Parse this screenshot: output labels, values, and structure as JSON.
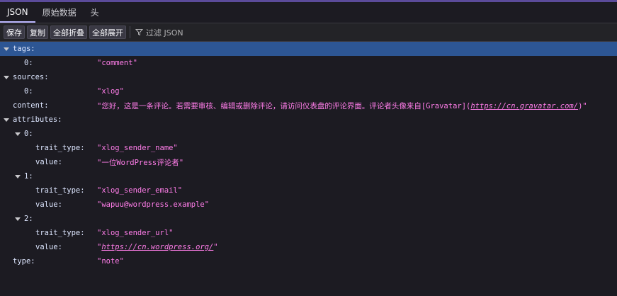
{
  "tabs": [
    {
      "label": "JSON"
    },
    {
      "label": "原始数据"
    },
    {
      "label": "头"
    }
  ],
  "toolbar": {
    "save": "保存",
    "copy": "复制",
    "collapse_all": "全部折叠",
    "expand_all": "全部展开",
    "filter_label": "过滤 JSON"
  },
  "tree": {
    "tags_key": "tags:",
    "tags_0_key": "0:",
    "tags_0_val": "\"comment\"",
    "sources_key": "sources:",
    "sources_0_key": "0:",
    "sources_0_val": "\"xlog\"",
    "content_key": "content:",
    "content_val_prefix": "\"您好，这是一条评论。若需要审核、编辑或删除评论，请访问仪表盘的评论界面。评论者头像来自[Gravatar](",
    "content_val_link": "https://cn.gravatar.com/",
    "content_val_suffix": ")\"",
    "attributes_key": "attributes:",
    "attr0_key": "0:",
    "attr0_trait_key": "trait_type:",
    "attr0_trait_val": "\"xlog_sender_name\"",
    "attr0_value_key": "value:",
    "attr0_value_val": "\"一位WordPress评论者\"",
    "attr1_key": "1:",
    "attr1_trait_key": "trait_type:",
    "attr1_trait_val": "\"xlog_sender_email\"",
    "attr1_value_key": "value:",
    "attr1_value_val": "\"wapuu@wordpress.example\"",
    "attr2_key": "2:",
    "attr2_trait_key": "trait_type:",
    "attr2_trait_val": "\"xlog_sender_url\"",
    "attr2_value_key": "value:",
    "attr2_value_quote_open": "\"",
    "attr2_value_link": "https://cn.wordpress.org/",
    "attr2_value_quote_close": "\"",
    "type_key": "type:",
    "type_val": "\"note\""
  },
  "colors": {
    "background": "#1c1b22",
    "selection": "#2d5694",
    "string_value": "#ff7de9",
    "active_tab_underline": "#bbb6ff"
  },
  "icons": {
    "filter": "funnel-icon",
    "expand": "triangle-down-icon"
  }
}
